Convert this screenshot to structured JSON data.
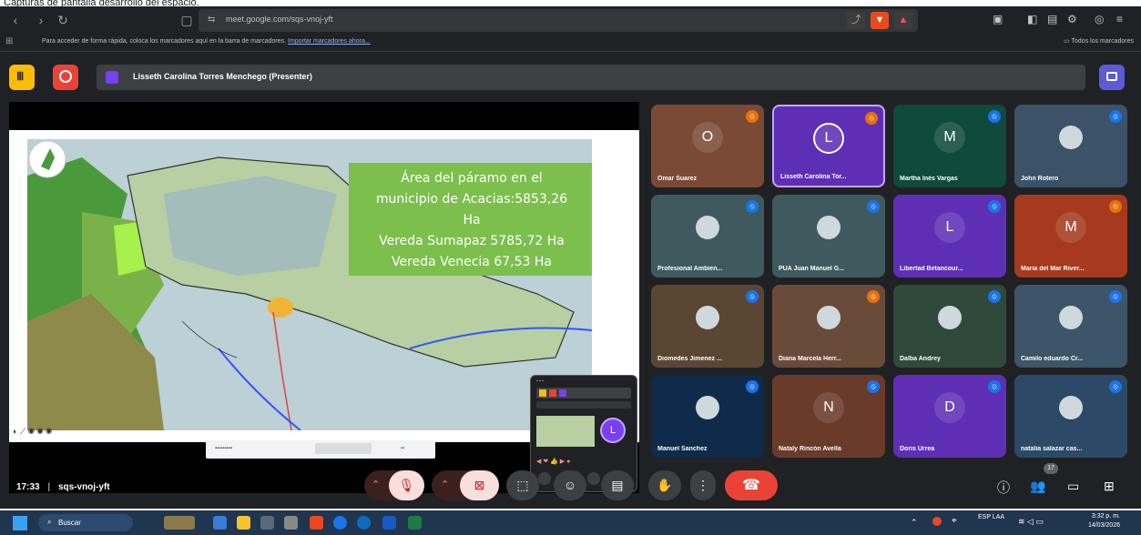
{
  "caption": "Capturas de pantalla desarrollo del espacio.",
  "browser": {
    "url": "meet.google.com/sqs-vnoj-yft",
    "bookmarks_hint": "Para acceder de forma rápida, coloca los marcadores aquí en la barra de marcadores.",
    "bookmarks_link": "Importar marcadores ahora...",
    "bookmarks_folder": "Todos los marcadores"
  },
  "meet": {
    "presenter_label": "Lisseth Carolina Torres Menchego (Presenter)",
    "meeting_time": "17:33",
    "meeting_code": "sqs-vnoj-yft",
    "participant_count": "17"
  },
  "slide": {
    "lines": [
      "Área del páramo en el",
      "municipio de Acacias:5853,26",
      "Ha",
      "Vereda Sumapaz 5785,72 Ha",
      "Vereda Venecia 67,53 Ha"
    ]
  },
  "participants": [
    {
      "name": "Omar Suarez",
      "initial": "O",
      "bg": "#7a4a36"
    },
    {
      "name": "Lisseth Carolina Tor...",
      "initial": "L",
      "bg": "#5e2fb5"
    },
    {
      "name": "Martha Inés Vargas",
      "initial": "M",
      "bg": "#0f4a3c"
    },
    {
      "name": "John Rotero",
      "initial": "",
      "bg": "#3b5268"
    },
    {
      "name": "Profesional Ambien...",
      "initial": "",
      "bg": "#3f5a5e"
    },
    {
      "name": "PUA Juan Manuel G...",
      "initial": "",
      "bg": "#3f5a5e"
    },
    {
      "name": "Libertad Betancour...",
      "initial": "L",
      "bg": "#5e2fb5"
    },
    {
      "name": "Maria del Mar River...",
      "initial": "M",
      "bg": "#a6391e"
    },
    {
      "name": "Diomedes Jimenez ...",
      "initial": "",
      "bg": "#5b4634"
    },
    {
      "name": "Diana Marcela Herr...",
      "initial": "",
      "bg": "#6a4b3a"
    },
    {
      "name": "Dalba Andrey",
      "initial": "",
      "bg": "#2f4a3a"
    },
    {
      "name": "Camilo eduardo Cr...",
      "initial": "",
      "bg": "#3c5568"
    },
    {
      "name": "Manuel Sanchez",
      "initial": "",
      "bg": "#0f2a4a"
    },
    {
      "name": "Nataly Rincón Avella",
      "initial": "N",
      "bg": "#6a3a2a"
    },
    {
      "name": "Doris Urrea",
      "initial": "D",
      "bg": "#5e2fb5"
    },
    {
      "name": "natalia salazar cas...",
      "initial": "",
      "bg": "#2c4a68"
    }
  ],
  "taskbar": {
    "search_label": "Buscar",
    "lang": "ESP LAA",
    "time": "3:32 p. m.",
    "date": "14/03/2026"
  },
  "colors": {
    "meet_bg": "#202124",
    "end_call": "#ea4335",
    "mic_off": "#f28b82"
  }
}
